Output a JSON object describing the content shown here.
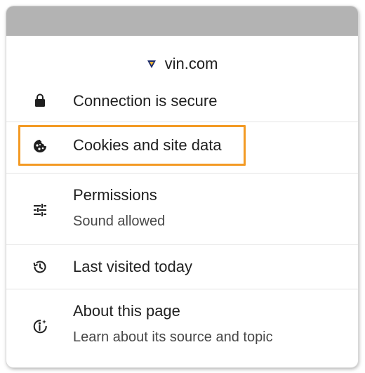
{
  "site": {
    "domain": "vin.com",
    "favicon": "vin-logo-icon"
  },
  "items": [
    {
      "label": "Connection is secure",
      "icon": "lock-icon"
    },
    {
      "label": "Cookies and site data",
      "icon": "cookie-icon",
      "highlighted": true
    },
    {
      "label": "Permissions",
      "sub": "Sound allowed",
      "icon": "tune-icon"
    },
    {
      "label": "Last visited today",
      "icon": "history-icon"
    },
    {
      "label": "About this page",
      "sub": "Learn about its source and topic",
      "icon": "info-spark-icon"
    }
  ],
  "colors": {
    "highlight": "#f39a24",
    "topbar": "#b3b3b3",
    "text": "#1f1f1f",
    "subtext": "#474747"
  }
}
